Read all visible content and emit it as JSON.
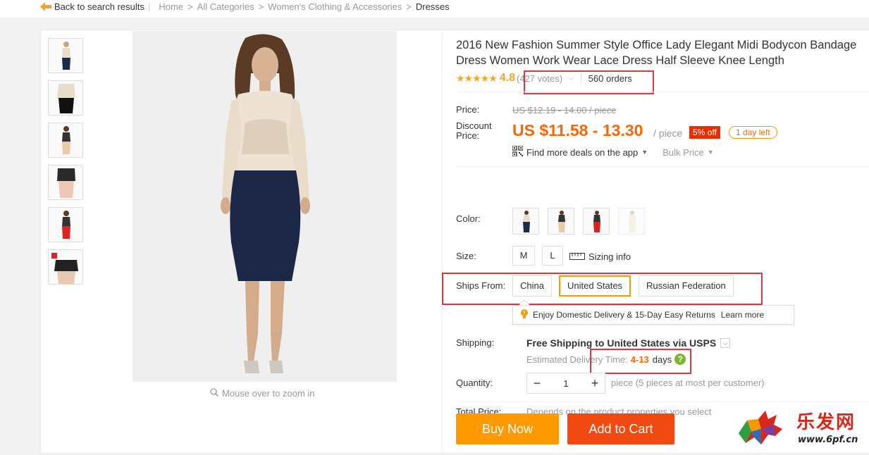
{
  "topbar": {
    "back_label": "Back to search results",
    "breadcrumbs": [
      "Home",
      "All Categories",
      "Women's Clothing & Accessories",
      "Dresses"
    ],
    "separator": ">"
  },
  "gallery": {
    "zoom_hint": "Mouse over to zoom in"
  },
  "product": {
    "title": "2016 New Fashion Summer Style Office Lady Elegant Midi Bodycon Bandage Dress Women Work Wear Lace Dress Half Sleeve Knee Length",
    "stars": "★★★★★",
    "rating": "4.8",
    "votes": "(427 votes)",
    "orders": "560 orders"
  },
  "price": {
    "price_label": "Price:",
    "old_price": "US $12.19 - 14.00 / piece",
    "discount_label_1": "Discount",
    "discount_label_2": "Price:",
    "discount_price": "US $11.58 - 13.30",
    "per_piece": "/ piece",
    "off_badge": "5% off",
    "days_left": "1 day left",
    "app_deals": "Find more deals on the app",
    "bulk_price": "Bulk Price"
  },
  "variants": {
    "color_label": "Color:",
    "size_label": "Size:",
    "sizes": [
      "M",
      "L"
    ],
    "sizing_info": "Sizing info",
    "ships_from_label": "Ships From:",
    "ships_from": [
      "China",
      "United States",
      "Russian Federation"
    ],
    "ships_from_selected": "United States",
    "tip_text": "Enjoy Domestic Delivery & 15-Day Easy Returns",
    "tip_link": "Learn more"
  },
  "shipping": {
    "label": "Shipping:",
    "method": "Free Shipping to United States via USPS",
    "est_label": "Estimated Delivery Time:",
    "est_days": "4-13",
    "est_unit": "days",
    "help": "?"
  },
  "quantity": {
    "label": "Quantity:",
    "minus": "−",
    "value": "1",
    "plus": "+",
    "note": "piece (5 pieces at most per customer)"
  },
  "total": {
    "label": "Total Price:",
    "note": "Depends on the product properties you select"
  },
  "actions": {
    "buy_now": "Buy Now",
    "add_to_cart": "Add to Cart"
  },
  "watermark": {
    "cn": "乐发网",
    "url": "www.6pf.cn"
  },
  "colors": {
    "accent_orange": "#f90",
    "cart_red": "#f04a12",
    "highlight_box": "#e2343e",
    "price_orange": "#f60"
  }
}
